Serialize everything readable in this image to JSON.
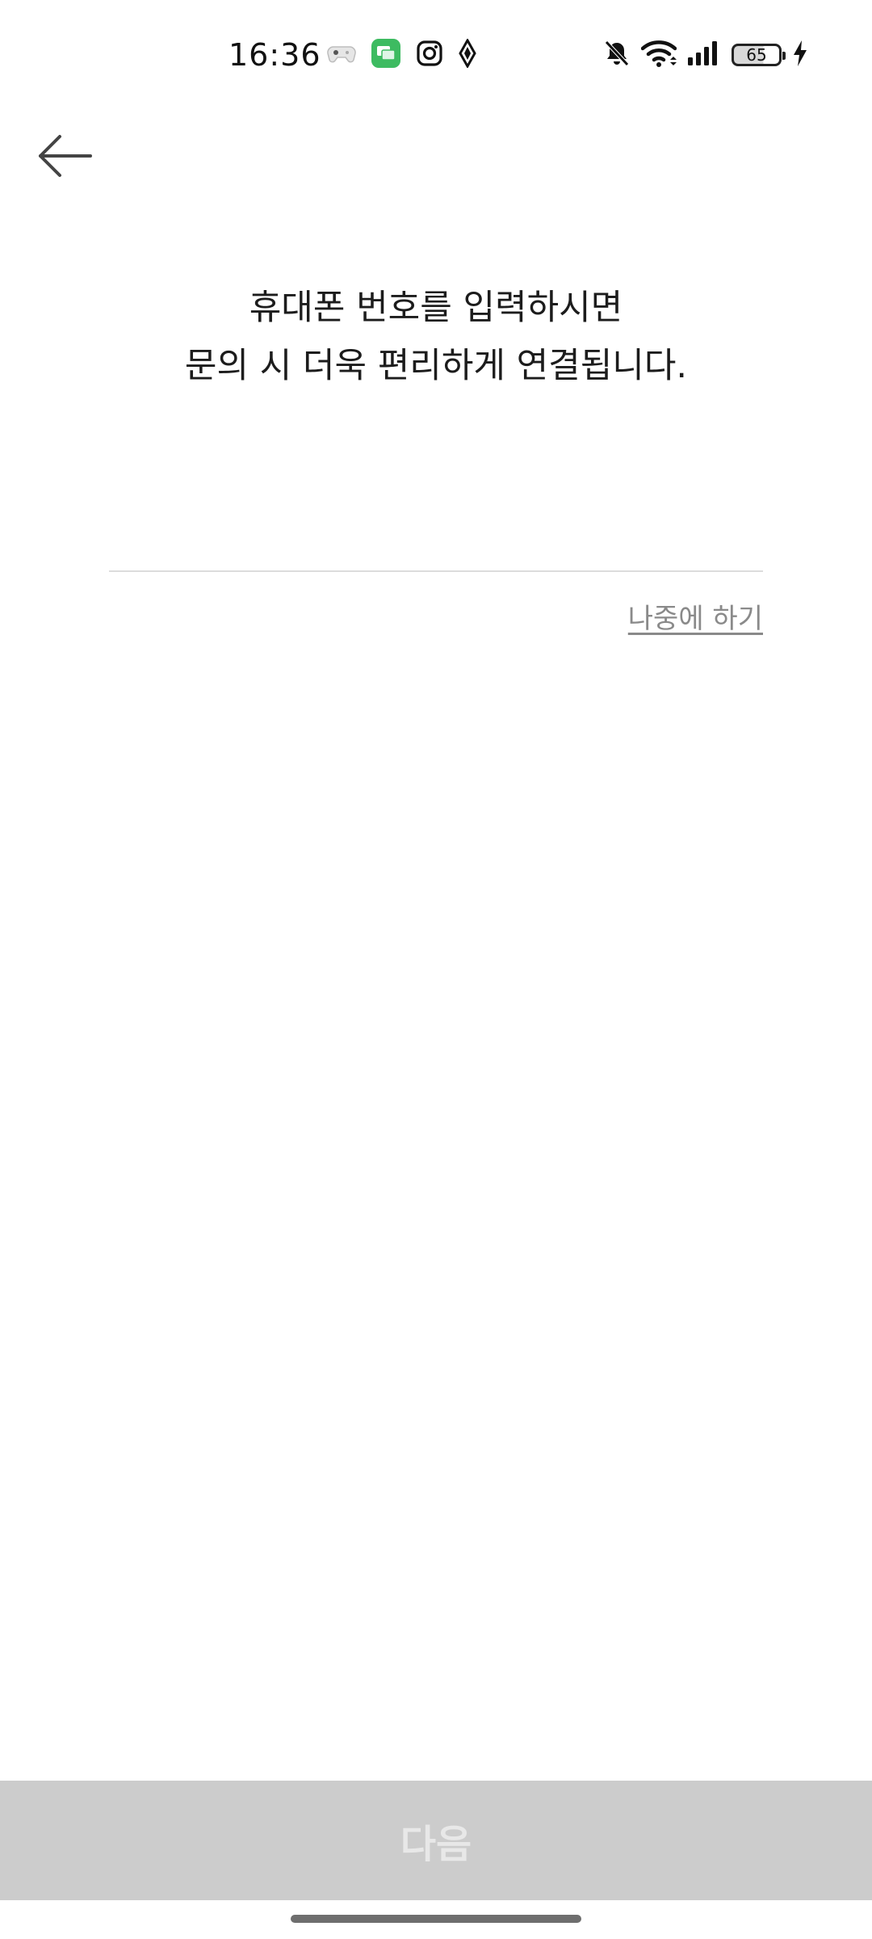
{
  "status_bar": {
    "time": "16:36",
    "notification_icons": [
      "gamepad-icon",
      "chat-app-icon",
      "instagram-icon",
      "navigation-icon"
    ],
    "system_icons": [
      "mute-bell-icon",
      "wifi-icon",
      "signal-icon",
      "battery-icon",
      "charging-icon"
    ],
    "battery_level": "65"
  },
  "header": {
    "back_icon": "arrow-left-icon"
  },
  "main": {
    "headline_line1": "휴대폰 번호를 입력하시면",
    "headline_line2": "문의 시 더욱 편리하게 연결됩니다.",
    "phone_input_value": "",
    "phone_input_placeholder": "",
    "later_label": "나중에 하기"
  },
  "footer": {
    "next_label": "다음",
    "next_bg": "#cccccc",
    "next_text_color": "#e8e8e8"
  }
}
